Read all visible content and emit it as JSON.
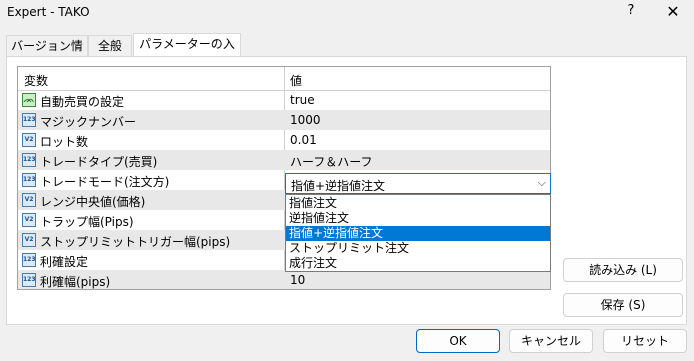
{
  "window": {
    "title": "Expert - TAKO",
    "help": "?",
    "close": "✕"
  },
  "tabs": [
    {
      "label": "バージョン情報"
    },
    {
      "label": "全般"
    },
    {
      "label": "パラメーターの入力"
    }
  ],
  "table": {
    "headers": {
      "name": "変数",
      "value": "値"
    },
    "rows": [
      {
        "name": "自動売買の設定",
        "value": "true",
        "icon": "bool-icon"
      },
      {
        "name": "マジックナンバー",
        "value": "1000",
        "icon": "int-icon"
      },
      {
        "name": "ロット数",
        "value": "0.01",
        "icon": "double-icon"
      },
      {
        "name": "トレードタイプ(売買)",
        "value": "ハーフ＆ハーフ",
        "icon": "int-icon"
      },
      {
        "name": "トレードモード(注文方)",
        "value": "",
        "icon": "int-icon"
      },
      {
        "name": "レンジ中央値(価格)",
        "value": "",
        "icon": "double-icon"
      },
      {
        "name": "トラップ幅(Pips)",
        "value": "",
        "icon": "double-icon"
      },
      {
        "name": "ストップリミットトリガー幅(pips)",
        "value": "",
        "icon": "double-icon"
      },
      {
        "name": "利確設定",
        "value": "",
        "icon": "int-icon"
      },
      {
        "name": "利確幅(pips)",
        "value": "10",
        "icon": "int-icon"
      }
    ]
  },
  "combo": {
    "selected": "指値+逆指値注文",
    "options": [
      "指値注文",
      "逆指値注文",
      "指値+逆指値注文",
      "ストップリミット注文",
      "成行注文"
    ]
  },
  "buttons": {
    "load": "読み込み (L)",
    "save": "保存 (S)",
    "ok": "OK",
    "cancel": "キャンセル",
    "reset": "リセット"
  },
  "icon_labels": {
    "int": "123",
    "double": "V2",
    "bool": "ᨏ"
  }
}
